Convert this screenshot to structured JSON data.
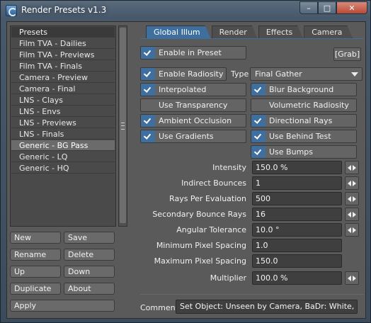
{
  "window": {
    "title": "Render Presets v1.3",
    "controls": {
      "minimize": "–",
      "maximize": "□",
      "close": "✕"
    }
  },
  "presets": {
    "items": [
      {
        "label": "Presets",
        "state": "header"
      },
      {
        "label": "Film TVA - Dailies",
        "state": "normal"
      },
      {
        "label": "Film TVA - Previews",
        "state": "normal"
      },
      {
        "label": "Film TVA - Finals",
        "state": "normal"
      },
      {
        "label": "Camera - Preview",
        "state": "normal"
      },
      {
        "label": "Camera - Final",
        "state": "normal"
      },
      {
        "label": "LNS - Clays",
        "state": "normal"
      },
      {
        "label": "LNS - Envs",
        "state": "normal"
      },
      {
        "label": "LNS - Previews",
        "state": "normal"
      },
      {
        "label": "LNS - Finals",
        "state": "normal"
      },
      {
        "label": "Generic - BG Pass",
        "state": "selected"
      },
      {
        "label": "Generic - LQ",
        "state": "normal"
      },
      {
        "label": "Generic - HQ",
        "state": "normal"
      }
    ]
  },
  "buttons": {
    "new": "New",
    "save": "Save",
    "rename": "Rename",
    "delete": "Delete",
    "up": "Up",
    "down": "Down",
    "duplicate": "Duplicate",
    "about": "About",
    "apply": "Apply"
  },
  "tabs": [
    {
      "label": "Global Illum",
      "active": true
    },
    {
      "label": "Render",
      "active": false
    },
    {
      "label": "Effects",
      "active": false
    },
    {
      "label": "Camera",
      "active": false
    }
  ],
  "global_illum": {
    "enable_in_preset": {
      "label": "Enable in Preset",
      "checked": true
    },
    "grab_label": "[Grab]",
    "enable_radiosity": {
      "label": "Enable Radiosity",
      "checked": true
    },
    "type_label": "Type",
    "type_value": "Final Gather",
    "interpolated": {
      "label": "Interpolated",
      "checked": true
    },
    "blur_background": {
      "label": "Blur Background",
      "checked": true
    },
    "use_transparency": {
      "label": "Use Transparency",
      "checked": false
    },
    "volumetric_radiosity": {
      "label": "Volumetric Radiosity",
      "checked": false
    },
    "ambient_occlusion": {
      "label": "Ambient Occlusion",
      "checked": true
    },
    "directional_rays": {
      "label": "Directional Rays",
      "checked": true
    },
    "use_gradients": {
      "label": "Use Gradients",
      "checked": true
    },
    "use_behind_test": {
      "label": "Use Behind Test",
      "checked": true
    },
    "use_bumps": {
      "label": "Use Bumps",
      "checked": true
    },
    "fields": {
      "intensity": {
        "label": "Intensity",
        "value": "150.0 %"
      },
      "indirect_bounces": {
        "label": "Indirect Bounces",
        "value": "1"
      },
      "rays_per_evaluation": {
        "label": "Rays Per Evaluation",
        "value": "500"
      },
      "secondary_bounce_rays": {
        "label": "Secondary Bounce Rays",
        "value": "16"
      },
      "angular_tolerance": {
        "label": "Angular Tolerance",
        "value": "10.0 °"
      },
      "min_pixel_spacing": {
        "label": "Minimum Pixel Spacing",
        "value": "1.0"
      },
      "max_pixel_spacing": {
        "label": "Maximum Pixel Spacing",
        "value": "150.0"
      },
      "multiplier": {
        "label": "Multiplier",
        "value": "100.0 %"
      }
    },
    "comment_label": "Comment",
    "comment_value": "Set Object: Unseen by Camera, BaDr: White, Dither:"
  },
  "colors": {
    "accent": "#3f6f9f",
    "panel": "#5a5a5a",
    "field": "#3f3f3f"
  }
}
